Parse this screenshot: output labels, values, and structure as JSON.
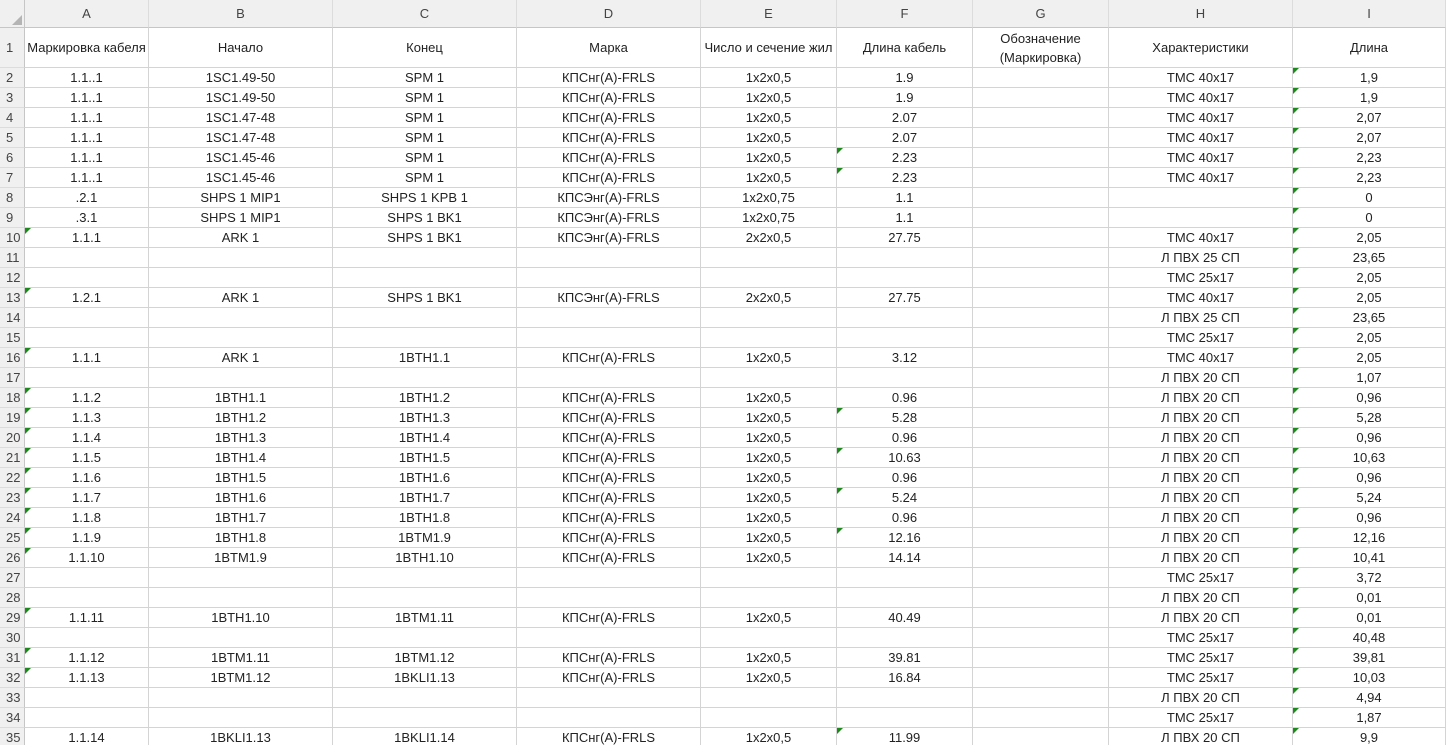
{
  "columns": [
    "A",
    "B",
    "C",
    "D",
    "E",
    "F",
    "G",
    "H",
    "I"
  ],
  "header_row": {
    "num": "1",
    "cells": [
      "Маркировка кабеля",
      "Начало",
      "Конец",
      "Марка",
      "Число и сечение жил",
      "Длина кабель",
      "Обозначение (Маркировка)",
      "Характеристики",
      "Длина"
    ]
  },
  "rows": [
    {
      "num": "2",
      "cells": [
        "1.1..1",
        "1SC1.49-50",
        "SPM 1",
        "КПСнг(А)-FRLS",
        "1x2x0,5",
        "1.9",
        "",
        "ТМС 40x17",
        "1,9"
      ],
      "flags": [
        "I"
      ]
    },
    {
      "num": "3",
      "cells": [
        "1.1..1",
        "1SC1.49-50",
        "SPM 1",
        "КПСнг(А)-FRLS",
        "1x2x0,5",
        "1.9",
        "",
        "ТМС 40x17",
        "1,9"
      ],
      "flags": [
        "I"
      ]
    },
    {
      "num": "4",
      "cells": [
        "1.1..1",
        "1SC1.47-48",
        "SPM 1",
        "КПСнг(А)-FRLS",
        "1x2x0,5",
        "2.07",
        "",
        "ТМС 40x17",
        "2,07"
      ],
      "flags": [
        "I"
      ]
    },
    {
      "num": "5",
      "cells": [
        "1.1..1",
        "1SC1.47-48",
        "SPM 1",
        "КПСнг(А)-FRLS",
        "1x2x0,5",
        "2.07",
        "",
        "ТМС 40x17",
        "2,07"
      ],
      "flags": [
        "I"
      ]
    },
    {
      "num": "6",
      "cells": [
        "1.1..1",
        "1SC1.45-46",
        "SPM 1",
        "КПСнг(А)-FRLS",
        "1x2x0,5",
        "2.23",
        "",
        "ТМС 40x17",
        "2,23"
      ],
      "flags": [
        "F",
        "I"
      ]
    },
    {
      "num": "7",
      "cells": [
        "1.1..1",
        "1SC1.45-46",
        "SPM 1",
        "КПСнг(А)-FRLS",
        "1x2x0,5",
        "2.23",
        "",
        "ТМС 40x17",
        "2,23"
      ],
      "flags": [
        "F",
        "I"
      ]
    },
    {
      "num": "8",
      "cells": [
        ".2.1",
        "SHPS 1 MIP1",
        "SHPS 1 KPB 1",
        "КПСЭнг(А)-FRLS",
        "1x2x0,75",
        "1.1",
        "",
        "",
        "0"
      ],
      "flags": [
        "I"
      ]
    },
    {
      "num": "9",
      "cells": [
        ".3.1",
        "SHPS 1 MIP1",
        "SHPS 1 BK1",
        "КПСЭнг(А)-FRLS",
        "1x2x0,75",
        "1.1",
        "",
        "",
        "0"
      ],
      "flags": [
        "I"
      ]
    },
    {
      "num": "10",
      "cells": [
        "1.1.1",
        "ARK 1",
        "SHPS 1 BK1",
        "КПСЭнг(А)-FRLS",
        "2x2x0,5",
        "27.75",
        "",
        "ТМС 40x17",
        "2,05"
      ],
      "flags": [
        "A",
        "I"
      ]
    },
    {
      "num": "11",
      "cells": [
        "",
        "",
        "",
        "",
        "",
        "",
        "",
        "Л  ПВХ 25 СП",
        "23,65"
      ],
      "flags": [
        "I"
      ]
    },
    {
      "num": "12",
      "cells": [
        "",
        "",
        "",
        "",
        "",
        "",
        "",
        "ТМС 25x17",
        "2,05"
      ],
      "flags": [
        "I"
      ]
    },
    {
      "num": "13",
      "cells": [
        "1.2.1",
        "ARK 1",
        "SHPS 1 BK1",
        "КПСЭнг(А)-FRLS",
        "2x2x0,5",
        "27.75",
        "",
        "ТМС 40x17",
        "2,05"
      ],
      "flags": [
        "A",
        "I"
      ]
    },
    {
      "num": "14",
      "cells": [
        "",
        "",
        "",
        "",
        "",
        "",
        "",
        "Л  ПВХ 25 СП",
        "23,65"
      ],
      "flags": [
        "I"
      ]
    },
    {
      "num": "15",
      "cells": [
        "",
        "",
        "",
        "",
        "",
        "",
        "",
        "ТМС 25x17",
        "2,05"
      ],
      "flags": [
        "I"
      ]
    },
    {
      "num": "16",
      "cells": [
        "1.1.1",
        "ARK 1",
        "1BTH1.1",
        "КПСнг(А)-FRLS",
        "1x2x0,5",
        "3.12",
        "",
        "ТМС 40x17",
        "2,05"
      ],
      "flags": [
        "A",
        "I"
      ]
    },
    {
      "num": "17",
      "cells": [
        "",
        "",
        "",
        "",
        "",
        "",
        "",
        "Л  ПВХ 20 СП",
        "1,07"
      ],
      "flags": [
        "I"
      ]
    },
    {
      "num": "18",
      "cells": [
        "1.1.2",
        "1BTH1.1",
        "1BTH1.2",
        "КПСнг(А)-FRLS",
        "1x2x0,5",
        "0.96",
        "",
        "Л  ПВХ 20 СП",
        "0,96"
      ],
      "flags": [
        "A",
        "I"
      ]
    },
    {
      "num": "19",
      "cells": [
        "1.1.3",
        "1BTH1.2",
        "1BTH1.3",
        "КПСнг(А)-FRLS",
        "1x2x0,5",
        "5.28",
        "",
        "Л  ПВХ 20 СП",
        "5,28"
      ],
      "flags": [
        "A",
        "F",
        "I"
      ]
    },
    {
      "num": "20",
      "cells": [
        "1.1.4",
        "1BTH1.3",
        "1BTH1.4",
        "КПСнг(А)-FRLS",
        "1x2x0,5",
        "0.96",
        "",
        "Л  ПВХ 20 СП",
        "0,96"
      ],
      "flags": [
        "A",
        "I"
      ]
    },
    {
      "num": "21",
      "cells": [
        "1.1.5",
        "1BTH1.4",
        "1BTH1.5",
        "КПСнг(А)-FRLS",
        "1x2x0,5",
        "10.63",
        "",
        "Л  ПВХ 20 СП",
        "10,63"
      ],
      "flags": [
        "A",
        "F",
        "I"
      ]
    },
    {
      "num": "22",
      "cells": [
        "1.1.6",
        "1BTH1.5",
        "1BTH1.6",
        "КПСнг(А)-FRLS",
        "1x2x0,5",
        "0.96",
        "",
        "Л  ПВХ 20 СП",
        "0,96"
      ],
      "flags": [
        "A",
        "I"
      ]
    },
    {
      "num": "23",
      "cells": [
        "1.1.7",
        "1BTH1.6",
        "1BTH1.7",
        "КПСнг(А)-FRLS",
        "1x2x0,5",
        "5.24",
        "",
        "Л  ПВХ 20 СП",
        "5,24"
      ],
      "flags": [
        "A",
        "F",
        "I"
      ]
    },
    {
      "num": "24",
      "cells": [
        "1.1.8",
        "1BTH1.7",
        "1BTH1.8",
        "КПСнг(А)-FRLS",
        "1x2x0,5",
        "0.96",
        "",
        "Л  ПВХ 20 СП",
        "0,96"
      ],
      "flags": [
        "A",
        "I"
      ]
    },
    {
      "num": "25",
      "cells": [
        "1.1.9",
        "1BTH1.8",
        "1BTM1.9",
        "КПСнг(А)-FRLS",
        "1x2x0,5",
        "12.16",
        "",
        "Л  ПВХ 20 СП",
        "12,16"
      ],
      "flags": [
        "A",
        "F",
        "I"
      ]
    },
    {
      "num": "26",
      "cells": [
        "1.1.10",
        "1BTM1.9",
        "1BTH1.10",
        "КПСнг(А)-FRLS",
        "1x2x0,5",
        "14.14",
        "",
        "Л  ПВХ 20 СП",
        "10,41"
      ],
      "flags": [
        "A",
        "I"
      ]
    },
    {
      "num": "27",
      "cells": [
        "",
        "",
        "",
        "",
        "",
        "",
        "",
        "ТМС 25x17",
        "3,72"
      ],
      "flags": [
        "I"
      ]
    },
    {
      "num": "28",
      "cells": [
        "",
        "",
        "",
        "",
        "",
        "",
        "",
        "Л  ПВХ 20 СП",
        "0,01"
      ],
      "flags": [
        "I"
      ]
    },
    {
      "num": "29",
      "cells": [
        "1.1.11",
        "1BTH1.10",
        "1BTM1.11",
        "КПСнг(А)-FRLS",
        "1x2x0,5",
        "40.49",
        "",
        "Л  ПВХ 20 СП",
        "0,01"
      ],
      "flags": [
        "A",
        "I"
      ]
    },
    {
      "num": "30",
      "cells": [
        "",
        "",
        "",
        "",
        "",
        "",
        "",
        "ТМС 25x17",
        "40,48"
      ],
      "flags": [
        "I"
      ]
    },
    {
      "num": "31",
      "cells": [
        "1.1.12",
        "1BTM1.11",
        "1BTM1.12",
        "КПСнг(А)-FRLS",
        "1x2x0,5",
        "39.81",
        "",
        "ТМС 25x17",
        "39,81"
      ],
      "flags": [
        "A",
        "I"
      ]
    },
    {
      "num": "32",
      "cells": [
        "1.1.13",
        "1BTM1.12",
        "1BKLI1.13",
        "КПСнг(А)-FRLS",
        "1x2x0,5",
        "16.84",
        "",
        "ТМС 25x17",
        "10,03"
      ],
      "flags": [
        "A",
        "I"
      ]
    },
    {
      "num": "33",
      "cells": [
        "",
        "",
        "",
        "",
        "",
        "",
        "",
        "Л  ПВХ 20 СП",
        "4,94"
      ],
      "flags": [
        "I"
      ]
    },
    {
      "num": "34",
      "cells": [
        "",
        "",
        "",
        "",
        "",
        "",
        "",
        "ТМС 25x17",
        "1,87"
      ],
      "flags": [
        "I"
      ]
    },
    {
      "num": "35",
      "cells": [
        "1.1.14",
        "1BKLI1.13",
        "1BKLI1.14",
        "КПСнг(А)-FRLS",
        "1x2x0,5",
        "11.99",
        "",
        "Л  ПВХ 20 СП",
        "9,9"
      ],
      "flags": [
        "F",
        "I"
      ]
    }
  ]
}
